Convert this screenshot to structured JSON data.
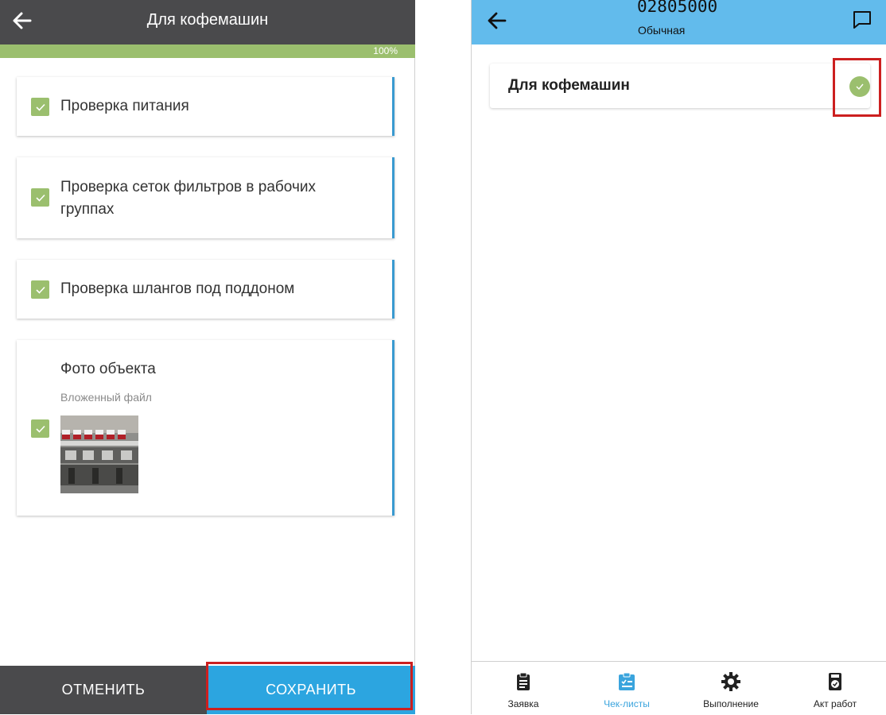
{
  "left": {
    "header": {
      "title": "Для кофемашин",
      "back_icon": "arrow-left-icon"
    },
    "progress": {
      "value_percent": 100,
      "label": "100%",
      "fill_color": "#9bbf6e"
    },
    "items": [
      {
        "label": "Проверка питания",
        "checked": true
      },
      {
        "label": "Проверка сеток фильтров в рабочих группах",
        "checked": true
      },
      {
        "label": "Проверка шлангов под поддоном",
        "checked": true
      },
      {
        "label": "Фото объекта",
        "sublabel": "Вложенный файл",
        "checked": true
      }
    ],
    "footer": {
      "cancel_label": "ОТМЕНИТЬ",
      "save_label": "СОХРАНИТЬ"
    }
  },
  "right": {
    "header": {
      "number": "02805000",
      "subtitle": "Обычная",
      "back_icon": "arrow-left-icon",
      "chat_icon": "chat-icon"
    },
    "checklist": {
      "title": "Для кофемашин",
      "completed": true
    },
    "nav": [
      {
        "label": "Заявка",
        "icon": "clipboard-icon",
        "active": false
      },
      {
        "label": "Чек-листы",
        "icon": "checklist-icon",
        "active": true
      },
      {
        "label": "Выполнение",
        "icon": "gear-icon",
        "active": false
      },
      {
        "label": "Акт работ",
        "icon": "act-icon",
        "active": false
      }
    ]
  },
  "colors": {
    "dark_header": "#4a4a4c",
    "light_header": "#62bbec",
    "accent_blue": "#2ca5e0",
    "check_green": "#9bbf6e",
    "highlight_red": "#cc1f1f"
  }
}
